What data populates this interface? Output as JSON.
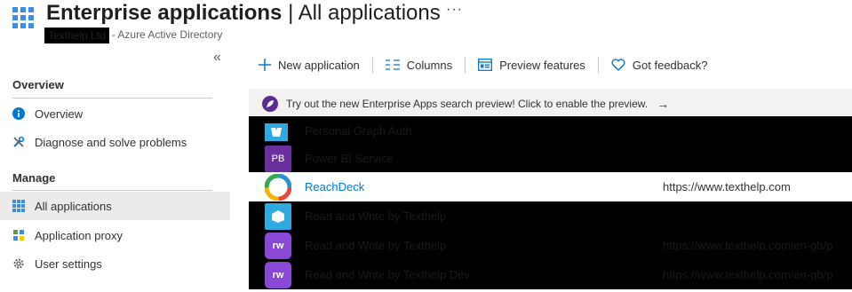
{
  "header": {
    "title_bold": "Enterprise applications",
    "title_rest": " | All applications",
    "more": "···",
    "tenant": "Texthelp Ltd",
    "subtitle": "- Azure Active Directory"
  },
  "sidebar": {
    "collapse": "«",
    "sections": [
      {
        "title": "Overview",
        "items": [
          {
            "label": "Overview",
            "icon": "info-icon"
          },
          {
            "label": "Diagnose and solve problems",
            "icon": "wrench-icon"
          }
        ]
      },
      {
        "title": "Manage",
        "items": [
          {
            "label": "All applications",
            "icon": "grid-icon",
            "active": true
          },
          {
            "label": "Application proxy",
            "icon": "proxy-icon"
          },
          {
            "label": "User settings",
            "icon": "gear-icon"
          }
        ]
      }
    ]
  },
  "toolbar": {
    "new_application": "New application",
    "columns": "Columns",
    "preview_features": "Preview features",
    "got_feedback": "Got feedback?"
  },
  "banner": {
    "text": "Try out the new Enterprise Apps search preview! Click to enable the preview.",
    "arrow": "→"
  },
  "apps": [
    {
      "name": "Personal Graph Auth",
      "url": "",
      "icon_text": "",
      "redacted": true
    },
    {
      "name": "Power BI Service",
      "url": "",
      "icon_text": "PB",
      "redacted": true
    },
    {
      "name": "ReachDeck",
      "url": "https://www.texthelp.com",
      "icon_text": "",
      "redacted": false
    },
    {
      "name": "Read and Write by Texthelp",
      "url": "",
      "icon_text": "",
      "redacted": true
    },
    {
      "name": "Read and Write by Texthelp",
      "url": "https://www.texthelp.com/en-gb/p",
      "icon_text": "rw",
      "redacted": true
    },
    {
      "name": "Read and Write by Texthelp Dev",
      "url": "https://www.texthelp.com/en-gb/p",
      "icon_text": "rw",
      "redacted": true
    }
  ],
  "colors": {
    "accent": "#0078d4",
    "banner_bg": "#f3f2f1",
    "active_nav": "#edebe9"
  }
}
